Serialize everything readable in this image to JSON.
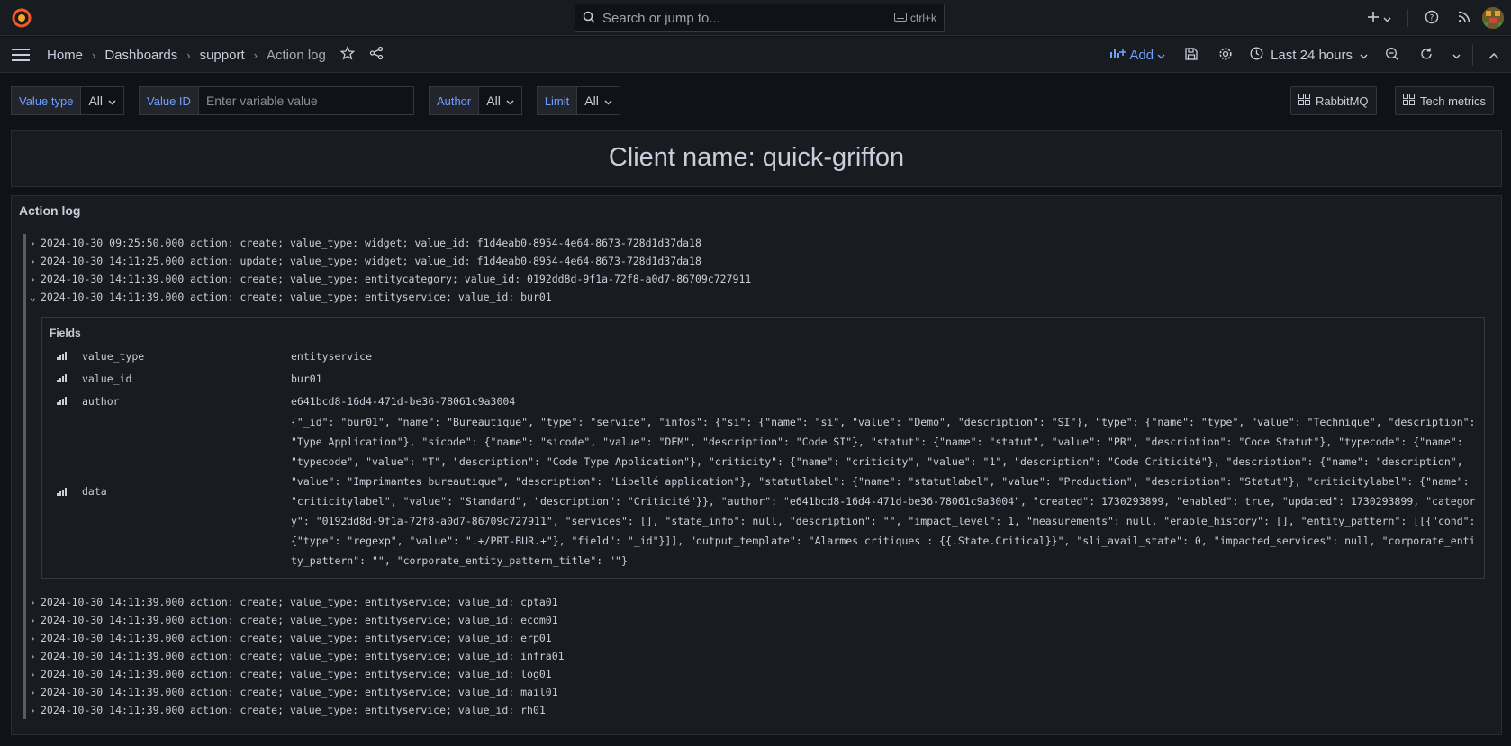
{
  "topbar": {
    "search_placeholder": "Search or jump to...",
    "search_shortcut": "ctrl+k"
  },
  "breadcrumb": [
    "Home",
    "Dashboards",
    "support",
    "Action log"
  ],
  "toolbar": {
    "add_label": "Add",
    "time_range": "Last 24 hours"
  },
  "variables": [
    {
      "label": "Value type",
      "value": "All"
    },
    {
      "label": "Value ID",
      "placeholder": "Enter variable value"
    },
    {
      "label": "Author",
      "value": "All"
    },
    {
      "label": "Limit",
      "value": "All"
    }
  ],
  "links": [
    "RabbitMQ",
    "Tech metrics"
  ],
  "client_panel": {
    "text": "Client name: quick-griffon"
  },
  "log_panel": {
    "title": "Action log",
    "rows_before": [
      "2024-10-30 09:25:50.000 action: create; value_type: widget; value_id: f1d4eab0-8954-4e64-8673-728d1d37da18",
      "2024-10-30 14:11:25.000 action: update; value_type: widget; value_id: f1d4eab0-8954-4e64-8673-728d1d37da18",
      "2024-10-30 14:11:39.000 action: create; value_type: entitycategory; value_id: 0192dd8d-9f1a-72f8-a0d7-86709c727911",
      "2024-10-30 14:11:39.000 action: create; value_type: entityservice; value_id: bur01"
    ],
    "fields_title": "Fields",
    "fields": [
      {
        "key": "value_type",
        "value": "entityservice"
      },
      {
        "key": "value_id",
        "value": "bur01"
      },
      {
        "key": "author",
        "value": "e641bcd8-16d4-471d-be36-78061c9a3004"
      },
      {
        "key": "data",
        "value": "{\"_id\": \"bur01\", \"name\": \"Bureautique\", \"type\": \"service\", \"infos\": {\"si\": {\"name\": \"si\", \"value\": \"Demo\", \"description\": \"SI\"}, \"type\": {\"name\": \"type\", \"value\": \"Technique\", \"description\": \"Type Application\"}, \"sicode\": {\"name\": \"sicode\", \"value\": \"DEM\", \"description\": \"Code SI\"}, \"statut\": {\"name\": \"statut\", \"value\": \"PR\", \"description\": \"Code Statut\"}, \"typecode\": {\"name\": \"typecode\", \"value\": \"T\", \"description\": \"Code Type Application\"}, \"criticity\": {\"name\": \"criticity\", \"value\": \"1\", \"description\": \"Code Criticité\"}, \"description\": {\"name\": \"description\", \"value\": \"Imprimantes bureautique\", \"description\": \"Libellé application\"}, \"statutlabel\": {\"name\": \"statutlabel\", \"value\": \"Production\", \"description\": \"Statut\"}, \"criticitylabel\": {\"name\": \"criticitylabel\", \"value\": \"Standard\", \"description\": \"Criticité\"}}, \"author\": \"e641bcd8-16d4-471d-be36-78061c9a3004\", \"created\": 1730293899, \"enabled\": true, \"updated\": 1730293899, \"category\": \"0192dd8d-9f1a-72f8-a0d7-86709c727911\", \"services\": [], \"state_info\": null, \"description\": \"\", \"impact_level\": 1, \"measurements\": null, \"enable_history\": [], \"entity_pattern\": [[{\"cond\": {\"type\": \"regexp\", \"value\": \".+/PRT-BUR.+\"}, \"field\": \"_id\"}]], \"output_template\": \"Alarmes critiques : {{.State.Critical}}\", \"sli_avail_state\": 0, \"impacted_services\": null, \"corporate_entity_pattern\": \"\", \"corporate_entity_pattern_title\": \"\"}"
      }
    ],
    "rows_after": [
      "2024-10-30 14:11:39.000 action: create; value_type: entityservice; value_id: cpta01",
      "2024-10-30 14:11:39.000 action: create; value_type: entityservice; value_id: ecom01",
      "2024-10-30 14:11:39.000 action: create; value_type: entityservice; value_id: erp01",
      "2024-10-30 14:11:39.000 action: create; value_type: entityservice; value_id: infra01",
      "2024-10-30 14:11:39.000 action: create; value_type: entityservice; value_id: log01",
      "2024-10-30 14:11:39.000 action: create; value_type: entityservice; value_id: mail01",
      "2024-10-30 14:11:39.000 action: create; value_type: entityservice; value_id: rh01"
    ]
  },
  "colors": {
    "accent": "#6e9fff",
    "brand": "#f05a28",
    "background": "#111217",
    "panel": "#181b1f"
  },
  "icons": [
    "grafana-logo-icon",
    "search-icon",
    "keyboard-icon",
    "plus-icon",
    "help-icon",
    "rss-icon",
    "avatar",
    "hamburger-icon",
    "star-icon",
    "share-icon",
    "add-panel-icon",
    "save-icon",
    "gear-icon",
    "clock-icon",
    "zoom-out-icon",
    "refresh-icon",
    "collapse-icon",
    "dashboard-link-icon",
    "bar-chart-icon",
    "chevron-right-icon",
    "chevron-down-icon"
  ]
}
